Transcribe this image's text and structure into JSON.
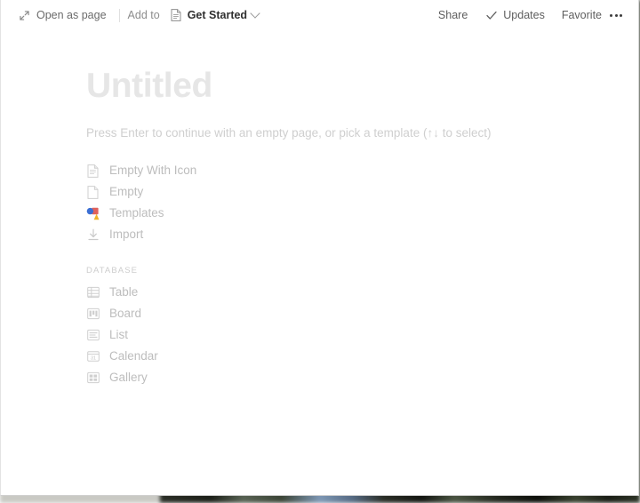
{
  "toolbar": {
    "open_as_page": "Open as page",
    "add_to_label": "Add to",
    "breadcrumb_page": "Get Started",
    "share": "Share",
    "updates": "Updates",
    "favorite": "Favorite",
    "more_menu": "•••",
    "icons": {
      "expand": "expand-diagonal-icon",
      "page": "page-document-icon",
      "chevron": "chevron-down-icon",
      "check": "check-icon",
      "more": "more-horizontal-icon"
    }
  },
  "page": {
    "title": "Untitled",
    "hint": "Press Enter to continue with an empty page, or pick a template (↑↓ to select)"
  },
  "templates": {
    "items": [
      {
        "label": "Empty With Icon",
        "icon": "document-lines-icon"
      },
      {
        "label": "Empty",
        "icon": "document-blank-icon"
      },
      {
        "label": "Templates",
        "icon": "shapes-color-icon"
      },
      {
        "label": "Import",
        "icon": "download-arrow-icon"
      }
    ]
  },
  "database": {
    "section_label": "DATABASE",
    "items": [
      {
        "label": "Table",
        "icon": "table-grid-icon"
      },
      {
        "label": "Board",
        "icon": "board-columns-icon"
      },
      {
        "label": "List",
        "icon": "list-lines-icon"
      },
      {
        "label": "Calendar",
        "icon": "calendar-31-icon",
        "day": "31"
      },
      {
        "label": "Gallery",
        "icon": "gallery-grid-icon"
      }
    ]
  },
  "colors": {
    "title_placeholder": "#e6e6e6",
    "muted_text": "#bdbdbd",
    "toolbar_text": "#6b6b6b",
    "breadcrumb_text": "#2f2f2f",
    "shape_blue": "#3b6fd4",
    "shape_red": "#e0625c",
    "shape_yellow": "#f0b429"
  }
}
